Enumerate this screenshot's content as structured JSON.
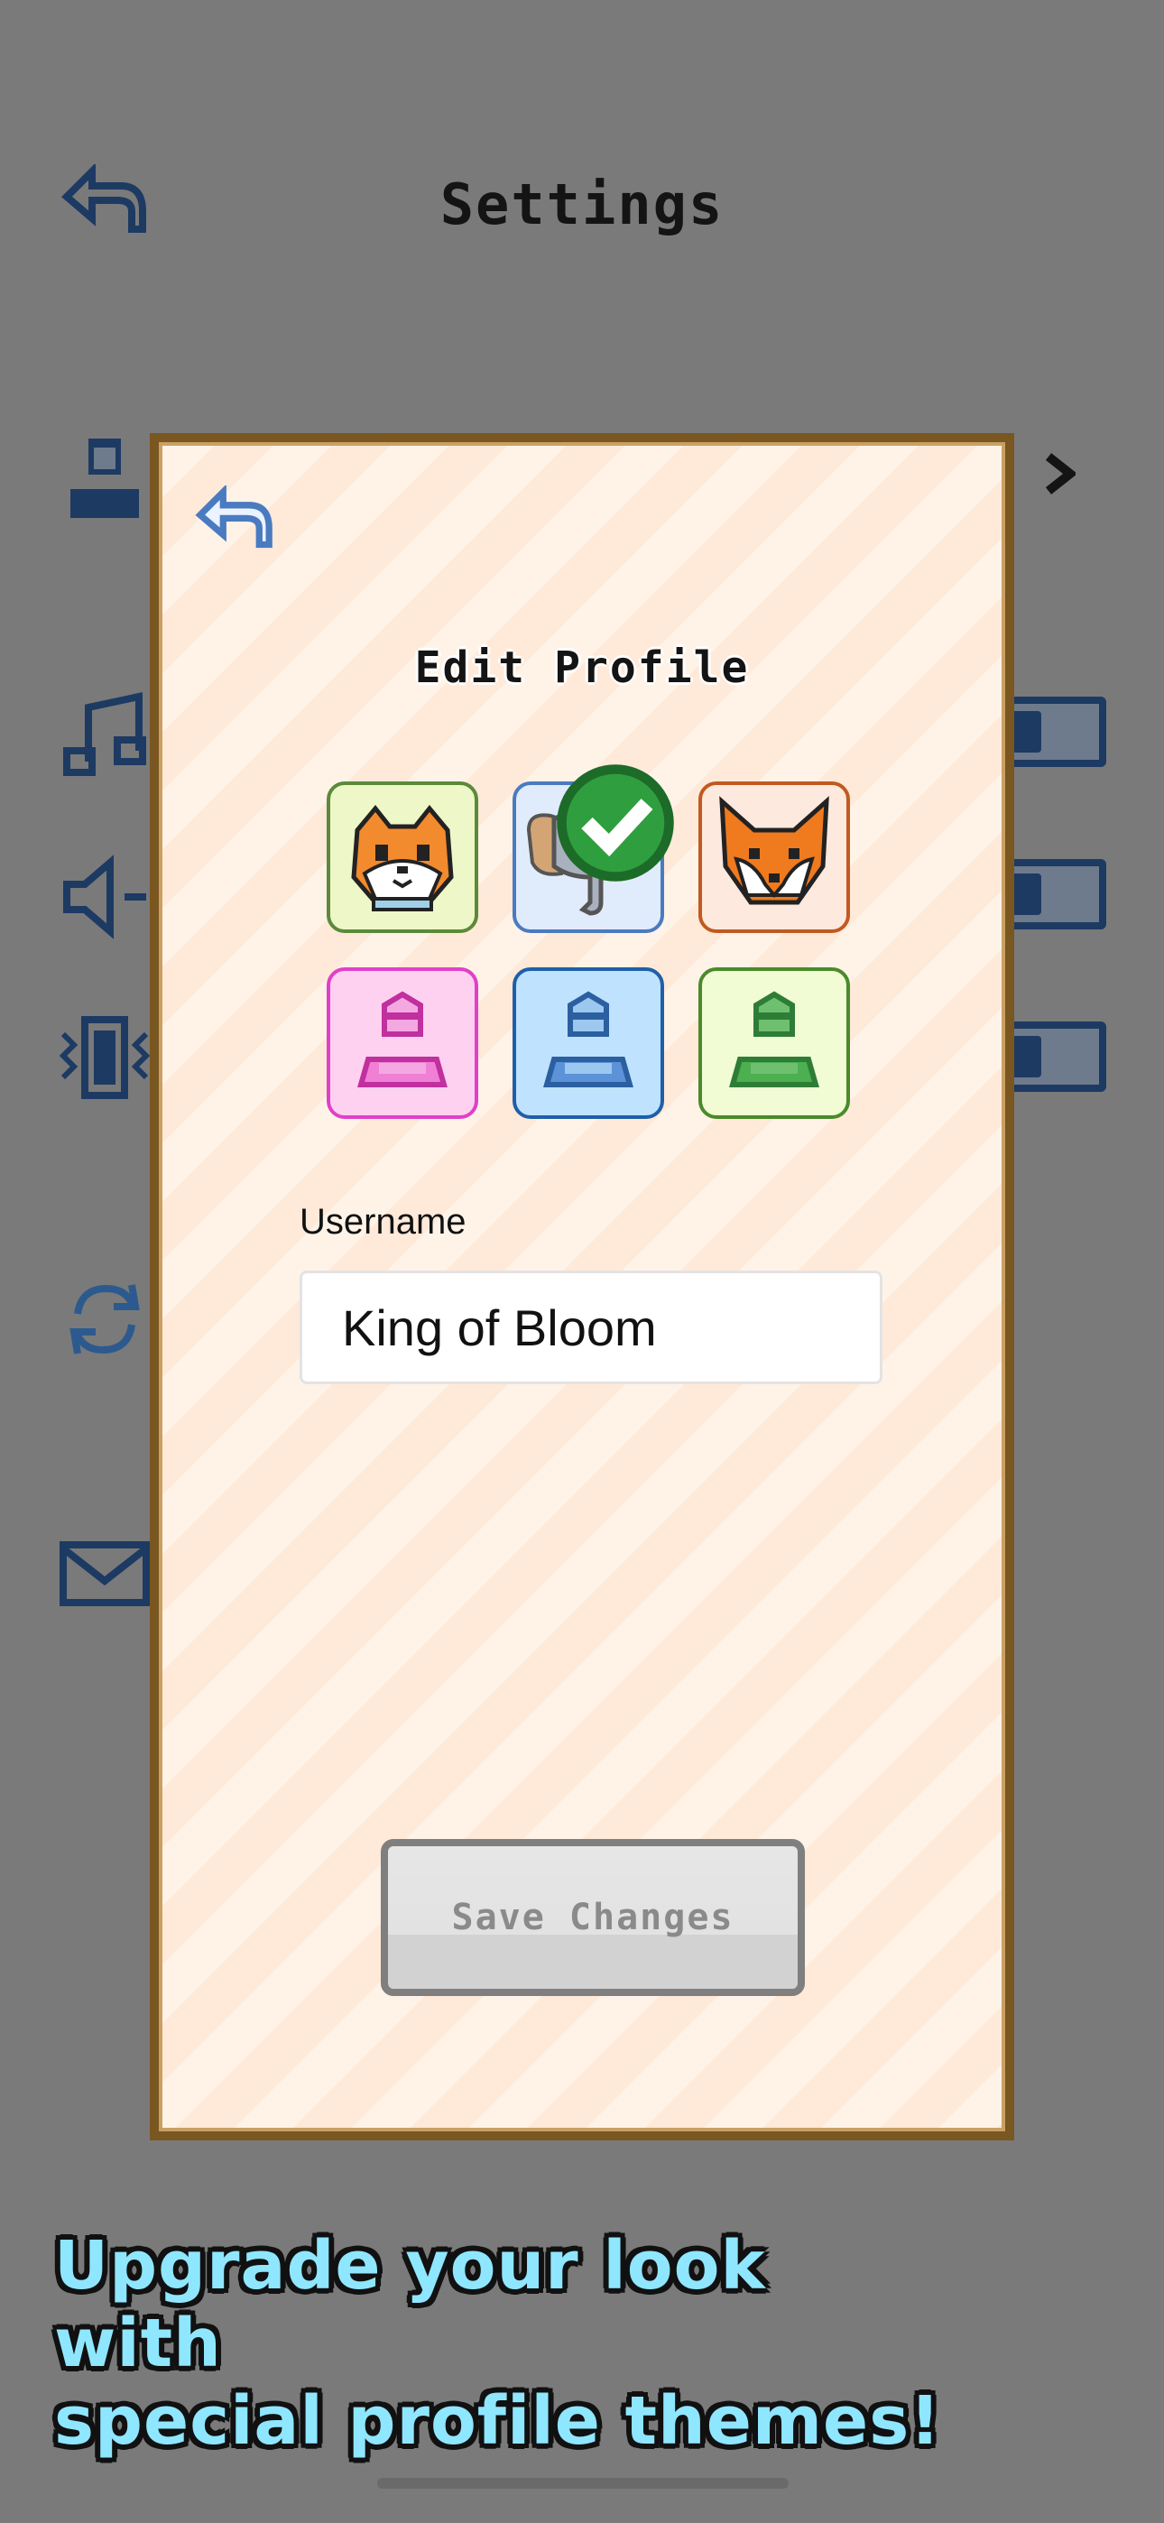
{
  "background": {
    "title": "Settings",
    "icons": [
      "back-arrow-icon",
      "user-icon",
      "music-note-icon",
      "speaker-icon",
      "vibration-icon",
      "refresh-icon",
      "mail-icon",
      "chevron-right-icon"
    ]
  },
  "modal": {
    "title": "Edit Profile",
    "avatars": [
      {
        "name": "hamster",
        "bg": "#eef7c8",
        "border": "#5b8a3a",
        "selected": false
      },
      {
        "name": "elephant",
        "bg": "#e0ecfb",
        "border": "#4a7bc0",
        "selected": true
      },
      {
        "name": "fox",
        "bg": "#fde9de",
        "border": "#c05a20",
        "selected": false
      },
      {
        "name": "person-pink",
        "bg": "#ffd1f0",
        "border": "#e040c8",
        "selected": false
      },
      {
        "name": "person-blue",
        "bg": "#bfe3ff",
        "border": "#1f5fa8",
        "selected": false
      },
      {
        "name": "person-green",
        "bg": "#f1fbd4",
        "border": "#4a8a2a",
        "selected": false
      }
    ],
    "username_label": "Username",
    "username_value": "King of Bloom",
    "save_label": "Save Changes"
  },
  "promo": {
    "line1": "Upgrade your look with",
    "line2": "special profile themes!"
  }
}
